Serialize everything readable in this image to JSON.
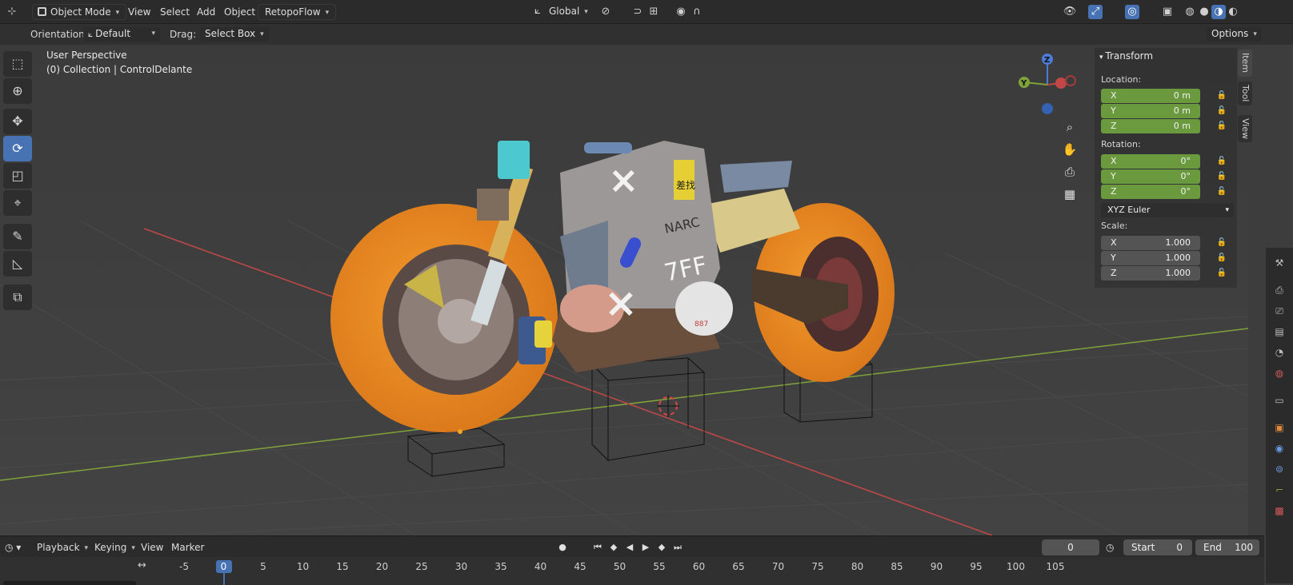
{
  "header": {
    "mode": "Object Mode",
    "menus": [
      "View",
      "Select",
      "Add",
      "Object"
    ],
    "addon_menu": "RetopoFlow",
    "transform_orientation": "Global",
    "options": "Options"
  },
  "tool_header": {
    "orientation_label": "Orientation:",
    "orientation_value": "Default",
    "drag_label": "Drag:",
    "drag_value": "Select Box"
  },
  "viewport": {
    "perspective": "User Perspective",
    "collection": "(0) Collection | ControlDelante",
    "gizmo": {
      "z": "Z",
      "y": "Y"
    },
    "decal_texts": [
      "NARC",
      "7FF",
      "差找",
      "887"
    ]
  },
  "toolbar": {
    "icons": [
      "select-box-icon",
      "cursor-icon",
      "move-icon",
      "rotate-icon",
      "scale-icon",
      "transform-icon",
      "annotate-icon",
      "measure-icon",
      "add-cube-icon"
    ],
    "active_index": 3
  },
  "n_panel": {
    "section": "Transform",
    "location_label": "Location:",
    "location": [
      {
        "axis": "X",
        "value": "0 m"
      },
      {
        "axis": "Y",
        "value": "0 m"
      },
      {
        "axis": "Z",
        "value": "0 m"
      }
    ],
    "rotation_label": "Rotation:",
    "rotation": [
      {
        "axis": "X",
        "value": "0°"
      },
      {
        "axis": "Y",
        "value": "0°"
      },
      {
        "axis": "Z",
        "value": "0°"
      }
    ],
    "rotation_mode": "XYZ Euler",
    "scale_label": "Scale:",
    "scale": [
      {
        "axis": "X",
        "value": "1.000"
      },
      {
        "axis": "Y",
        "value": "1.000"
      },
      {
        "axis": "Z",
        "value": "1.000"
      }
    ],
    "tabs": [
      "Item",
      "Tool",
      "View"
    ]
  },
  "timeline": {
    "menus": [
      "Playback",
      "Keying",
      "View",
      "Marker"
    ],
    "current_frame": "0",
    "start_label": "Start",
    "start_value": "0",
    "end_label": "End",
    "end_value": "100",
    "ticks": [
      "-5",
      "0",
      "5",
      "10",
      "15",
      "20",
      "25",
      "30",
      "35",
      "40",
      "45",
      "50",
      "55",
      "60",
      "65",
      "70",
      "75",
      "80",
      "85",
      "90",
      "95",
      "100",
      "105"
    ]
  },
  "colors": {
    "accent": "#4772b3",
    "field_green": "#6a9a3d",
    "wheel_orange": "#e98a1f",
    "x_axis": "#c24848",
    "y_axis": "#7fa33a"
  }
}
